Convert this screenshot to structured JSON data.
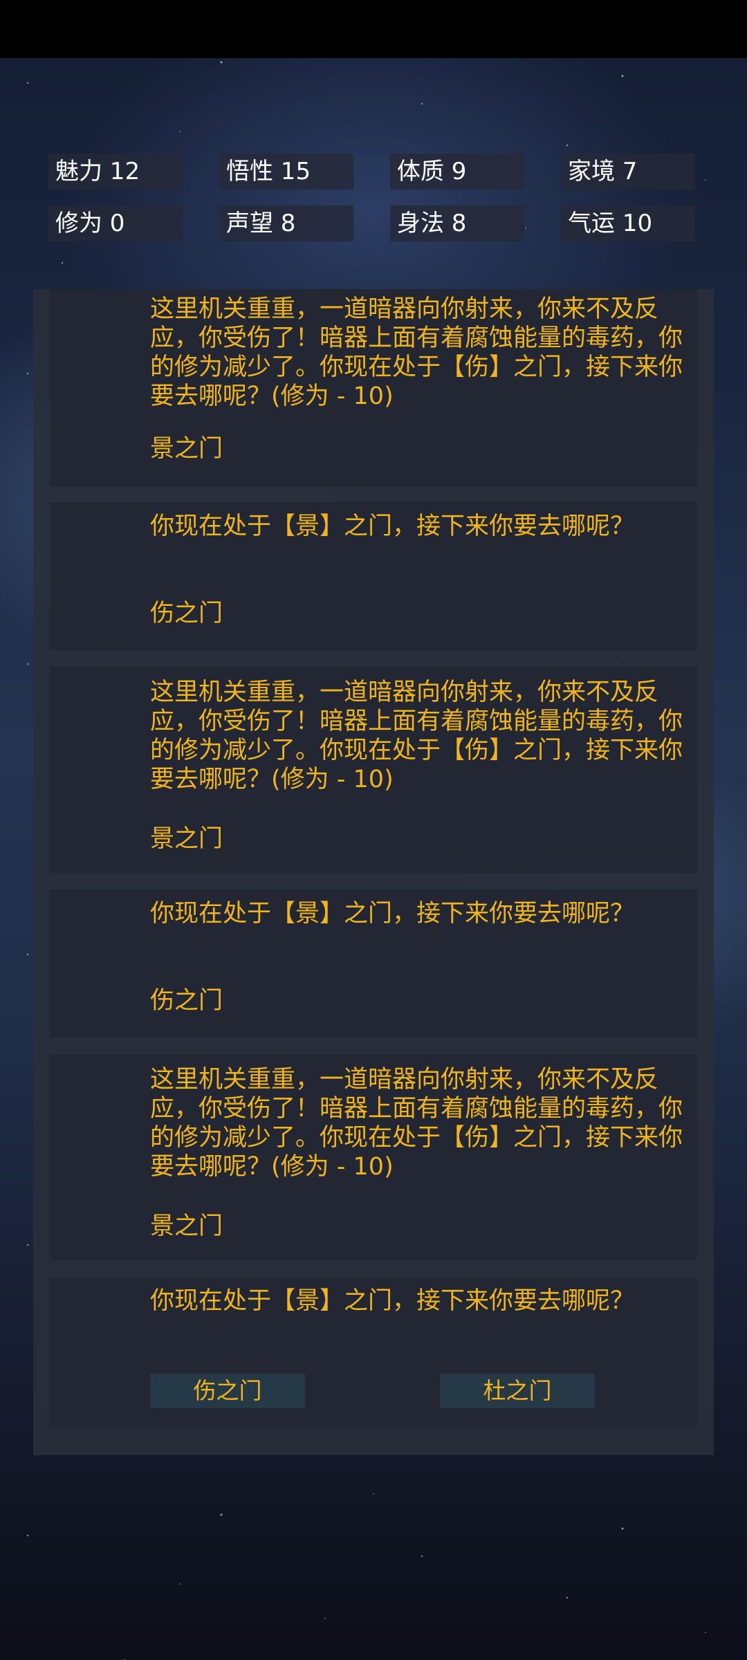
{
  "stats": [
    {
      "label": "魅力 12"
    },
    {
      "label": "悟性 15"
    },
    {
      "label": "体质 9"
    },
    {
      "label": "家境 7"
    },
    {
      "label": "修为 0"
    },
    {
      "label": "声望 8"
    },
    {
      "label": "身法 8"
    },
    {
      "label": "气运 10"
    }
  ],
  "log": [
    {
      "text": "这里机关重重，一道暗器向你射来，你来不及反应，你受伤了！暗器上面有着腐蚀能量的毒药，你的修为减少了。你现在处于【伤】之门，接下来你要去哪呢？(修为 - 10)",
      "result": "景之门"
    },
    {
      "text": "你现在处于【景】之门，接下来你要去哪呢？",
      "result": "伤之门"
    },
    {
      "text": "这里机关重重，一道暗器向你射来，你来不及反应，你受伤了！暗器上面有着腐蚀能量的毒药，你的修为减少了。你现在处于【伤】之门，接下来你要去哪呢？(修为 - 10)",
      "result": "景之门"
    },
    {
      "text": "你现在处于【景】之门，接下来你要去哪呢？",
      "result": "伤之门"
    },
    {
      "text": "这里机关重重，一道暗器向你射来，你来不及反应，你受伤了！暗器上面有着腐蚀能量的毒药，你的修为减少了。你现在处于【伤】之门，接下来你要去哪呢？(修为 - 10)",
      "result": "景之门"
    }
  ],
  "current": {
    "text": "你现在处于【景】之门，接下来你要去哪呢？",
    "choices": [
      "伤之门",
      "杜之门"
    ]
  }
}
